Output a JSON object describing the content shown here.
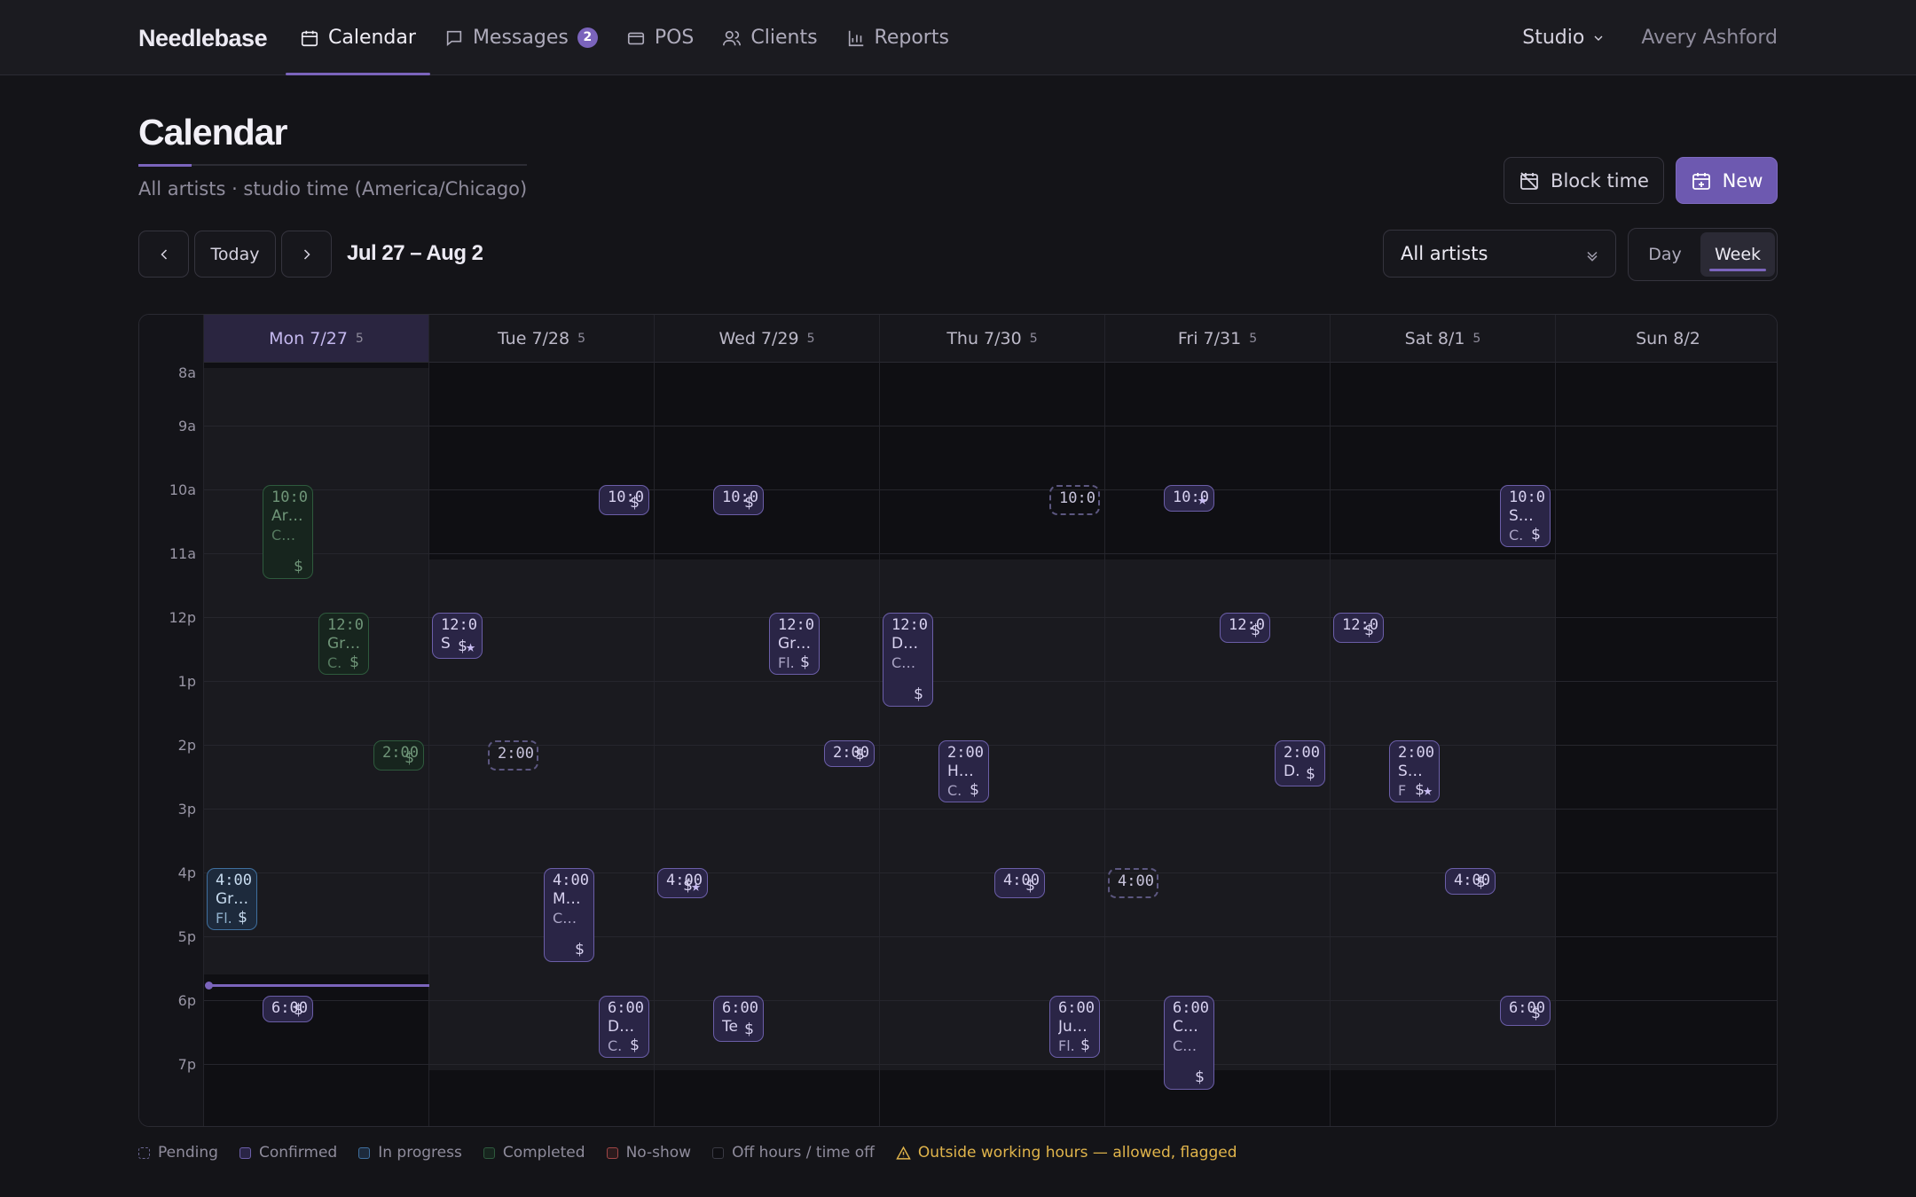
{
  "app": {
    "brand": "Needlebase"
  },
  "nav": {
    "items": [
      {
        "label": "Calendar",
        "icon": "calendar-icon",
        "active": true
      },
      {
        "label": "Messages",
        "icon": "message-icon",
        "badge": "2"
      },
      {
        "label": "POS",
        "icon": "card-icon"
      },
      {
        "label": "Clients",
        "icon": "users-icon"
      },
      {
        "label": "Reports",
        "icon": "bar-chart-icon"
      }
    ],
    "studio": "Studio",
    "user": "Avery Ashford"
  },
  "page": {
    "title": "Calendar",
    "subtitle": "All artists · studio time (America/Chicago)",
    "block_time_label": "Block time",
    "new_label": "New"
  },
  "toolbar": {
    "today_label": "Today",
    "range": "Jul 27 – Aug 2",
    "artist_filter": "All artists",
    "view_day": "Day",
    "view_week": "Week",
    "active_view": "Week"
  },
  "calendar": {
    "hours": [
      "8a",
      "9a",
      "10a",
      "11a",
      "12p",
      "1p",
      "2p",
      "3p",
      "4p",
      "5p",
      "6p",
      "7p"
    ],
    "days": [
      {
        "label": "Mon 7/27",
        "count": "5",
        "today": true
      },
      {
        "label": "Tue 7/28",
        "count": "5"
      },
      {
        "label": "Wed 7/29",
        "count": "5"
      },
      {
        "label": "Thu 7/30",
        "count": "5"
      },
      {
        "label": "Fri 7/31",
        "count": "5"
      },
      {
        "label": "Sat 8/1",
        "count": "5"
      },
      {
        "label": "Sun 8/2",
        "count": ""
      }
    ],
    "events": [
      {
        "day": 0,
        "start": 10,
        "end": 11.5,
        "lane": 1,
        "status": "completed",
        "time": "10:0",
        "l1": "Ar…",
        "l2": "C…",
        "dollar": true
      },
      {
        "day": 0,
        "start": 12,
        "end": 13,
        "lane": 2,
        "status": "completed",
        "time": "12:0",
        "l1": "Gr…",
        "l2": "C.",
        "dollar": true
      },
      {
        "day": 0,
        "start": 14,
        "end": 14.5,
        "lane": 3,
        "status": "completed",
        "time": "2:00",
        "dollar": true
      },
      {
        "day": 0,
        "start": 16,
        "end": 17,
        "lane": 0,
        "status": "progress",
        "time": "4:00",
        "l1": "Gr…",
        "l2": "Fl.",
        "dollar": true
      },
      {
        "day": 0,
        "start": 18,
        "end": 18.3,
        "lane": 1,
        "status": "confirmed",
        "time": "6:00",
        "dollar": true
      },
      {
        "day": 1,
        "start": 10,
        "end": 10.5,
        "lane": 3,
        "status": "confirmed",
        "time": "10:0",
        "dollar": true
      },
      {
        "day": 1,
        "start": 12,
        "end": 12.75,
        "lane": 0,
        "status": "confirmed",
        "time": "12:0",
        "l1": "S",
        "dollar": true,
        "star": true
      },
      {
        "day": 1,
        "start": 14,
        "end": 14.5,
        "lane": 1,
        "status": "pending",
        "time": "2:00"
      },
      {
        "day": 1,
        "start": 16,
        "end": 17.5,
        "lane": 2,
        "status": "confirmed",
        "time": "4:00",
        "l1": "M…",
        "l2": "C…",
        "dollar": true
      },
      {
        "day": 1,
        "start": 18,
        "end": 19,
        "lane": 3,
        "status": "confirmed",
        "time": "6:00",
        "l1": "D…",
        "l2": "C.",
        "dollar": true
      },
      {
        "day": 2,
        "start": 10,
        "end": 10.5,
        "lane": 1,
        "status": "confirmed",
        "time": "10:0",
        "dollar": true
      },
      {
        "day": 2,
        "start": 12,
        "end": 13,
        "lane": 2,
        "status": "confirmed",
        "time": "12:0",
        "l1": "Gr…",
        "l2": "Fl.",
        "dollar": true
      },
      {
        "day": 2,
        "start": 14,
        "end": 14.3,
        "lane": 3,
        "status": "confirmed",
        "time": "2:00",
        "dollar": true
      },
      {
        "day": 2,
        "start": 16,
        "end": 16.5,
        "lane": 0,
        "status": "confirmed",
        "time": "4:00",
        "dollar": true,
        "star": true
      },
      {
        "day": 2,
        "start": 18,
        "end": 18.75,
        "lane": 1,
        "status": "confirmed",
        "time": "6:00",
        "l1": "Te",
        "dollar": true
      },
      {
        "day": 3,
        "start": 10,
        "end": 10.5,
        "lane": 3,
        "status": "pending",
        "time": "10:0"
      },
      {
        "day": 3,
        "start": 12,
        "end": 13.5,
        "lane": 0,
        "status": "confirmed",
        "time": "12:0",
        "l1": "D…",
        "l2": "C…",
        "dollar": true
      },
      {
        "day": 3,
        "start": 14,
        "end": 15,
        "lane": 1,
        "status": "confirmed",
        "time": "2:00",
        "l1": "H…",
        "l2": "C.",
        "dollar": true
      },
      {
        "day": 3,
        "start": 16,
        "end": 16.5,
        "lane": 2,
        "status": "confirmed",
        "time": "4:00",
        "dollar": true
      },
      {
        "day": 3,
        "start": 18,
        "end": 19,
        "lane": 3,
        "status": "confirmed",
        "time": "6:00",
        "l1": "Ju…",
        "l2": "Fl.",
        "dollar": true
      },
      {
        "day": 4,
        "start": 10,
        "end": 10.3,
        "lane": 1,
        "status": "confirmed",
        "time": "10:0",
        "star": true
      },
      {
        "day": 4,
        "start": 12,
        "end": 12.5,
        "lane": 2,
        "status": "confirmed",
        "time": "12:0",
        "dollar": true
      },
      {
        "day": 4,
        "start": 14,
        "end": 14.75,
        "lane": 3,
        "status": "confirmed",
        "time": "2:00",
        "l1": "D.",
        "dollar": true
      },
      {
        "day": 4,
        "start": 16,
        "end": 16.5,
        "lane": 0,
        "status": "pending",
        "time": "4:00"
      },
      {
        "day": 4,
        "start": 18,
        "end": 19.5,
        "lane": 1,
        "status": "confirmed",
        "time": "6:00",
        "l1": "C…",
        "l2": "C…",
        "dollar": true
      },
      {
        "day": 5,
        "start": 12,
        "end": 12.5,
        "lane": 0,
        "status": "confirmed",
        "time": "12:0",
        "dollar": true
      },
      {
        "day": 5,
        "start": 14,
        "end": 15,
        "lane": 1,
        "status": "confirmed",
        "time": "2:00",
        "l1": "S…",
        "l2": "F",
        "dollar": true,
        "star": true
      },
      {
        "day": 5,
        "start": 16,
        "end": 16.3,
        "lane": 2,
        "status": "confirmed",
        "time": "4:00",
        "dollar": true
      },
      {
        "day": 5,
        "start": 10,
        "end": 11,
        "lane": 3,
        "status": "confirmed",
        "time": "10:0",
        "l1": "S…",
        "l2": "C.",
        "dollar": true
      },
      {
        "day": 5,
        "start": 18,
        "end": 18.5,
        "lane": 3,
        "status": "confirmed",
        "time": "6:00",
        "dollar": true
      }
    ]
  },
  "legend": {
    "items": [
      {
        "label": "Pending",
        "kind": "pending"
      },
      {
        "label": "Confirmed",
        "kind": "confirmed"
      },
      {
        "label": "In progress",
        "kind": "progress"
      },
      {
        "label": "Completed",
        "kind": "completed"
      },
      {
        "label": "No-show",
        "kind": "noshow"
      },
      {
        "label": "Off hours / time off",
        "kind": "off"
      }
    ],
    "warning": "Outside working hours — allowed, flagged"
  },
  "colors": {
    "accent": "#7b64bc",
    "confirmed": "#6b5ea8",
    "progress": "#3f6f9e",
    "completed": "#2e5a3d",
    "noshow": "#a04646",
    "warning": "#e0b44b"
  }
}
